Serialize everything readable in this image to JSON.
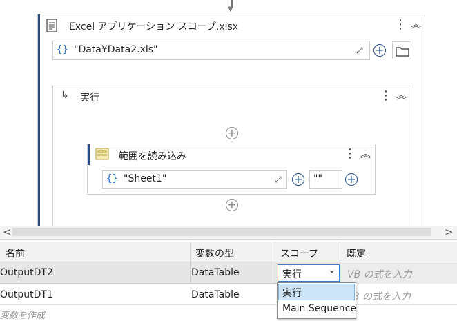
{
  "excel_scope": {
    "title": "Excel アプリケーション スコープ.xlsx",
    "path_value": "\"Data¥Data2.xls\"",
    "brace_label": "{}"
  },
  "execute": {
    "title": "実行"
  },
  "read_range": {
    "title": "範囲を読み込み",
    "sheet_value": "\"Sheet1\"",
    "range_value": "\"\"",
    "brace_label": "{}"
  },
  "icons": {
    "kebab": "⋮",
    "collapse": "︽",
    "plus": "+",
    "expand": "⤢",
    "arrow_down": "▼",
    "scroll_left": "<",
    "scroll_right": ">",
    "dropdown_arrow": "⌄"
  },
  "variables": {
    "headers": [
      "名前",
      "変数の型",
      "スコープ",
      "既定"
    ],
    "rows": [
      {
        "name": "OutputDT2",
        "type": "DataTable",
        "scope": "実行",
        "default_placeholder": "VB の式を入力"
      },
      {
        "name": "OutputDT1",
        "type": "DataTable",
        "scope": "",
        "default_placeholder": "B の式を入力"
      }
    ],
    "create_placeholder": "変数を作成",
    "scope_options": [
      "実行",
      "Main Sequence"
    ]
  }
}
